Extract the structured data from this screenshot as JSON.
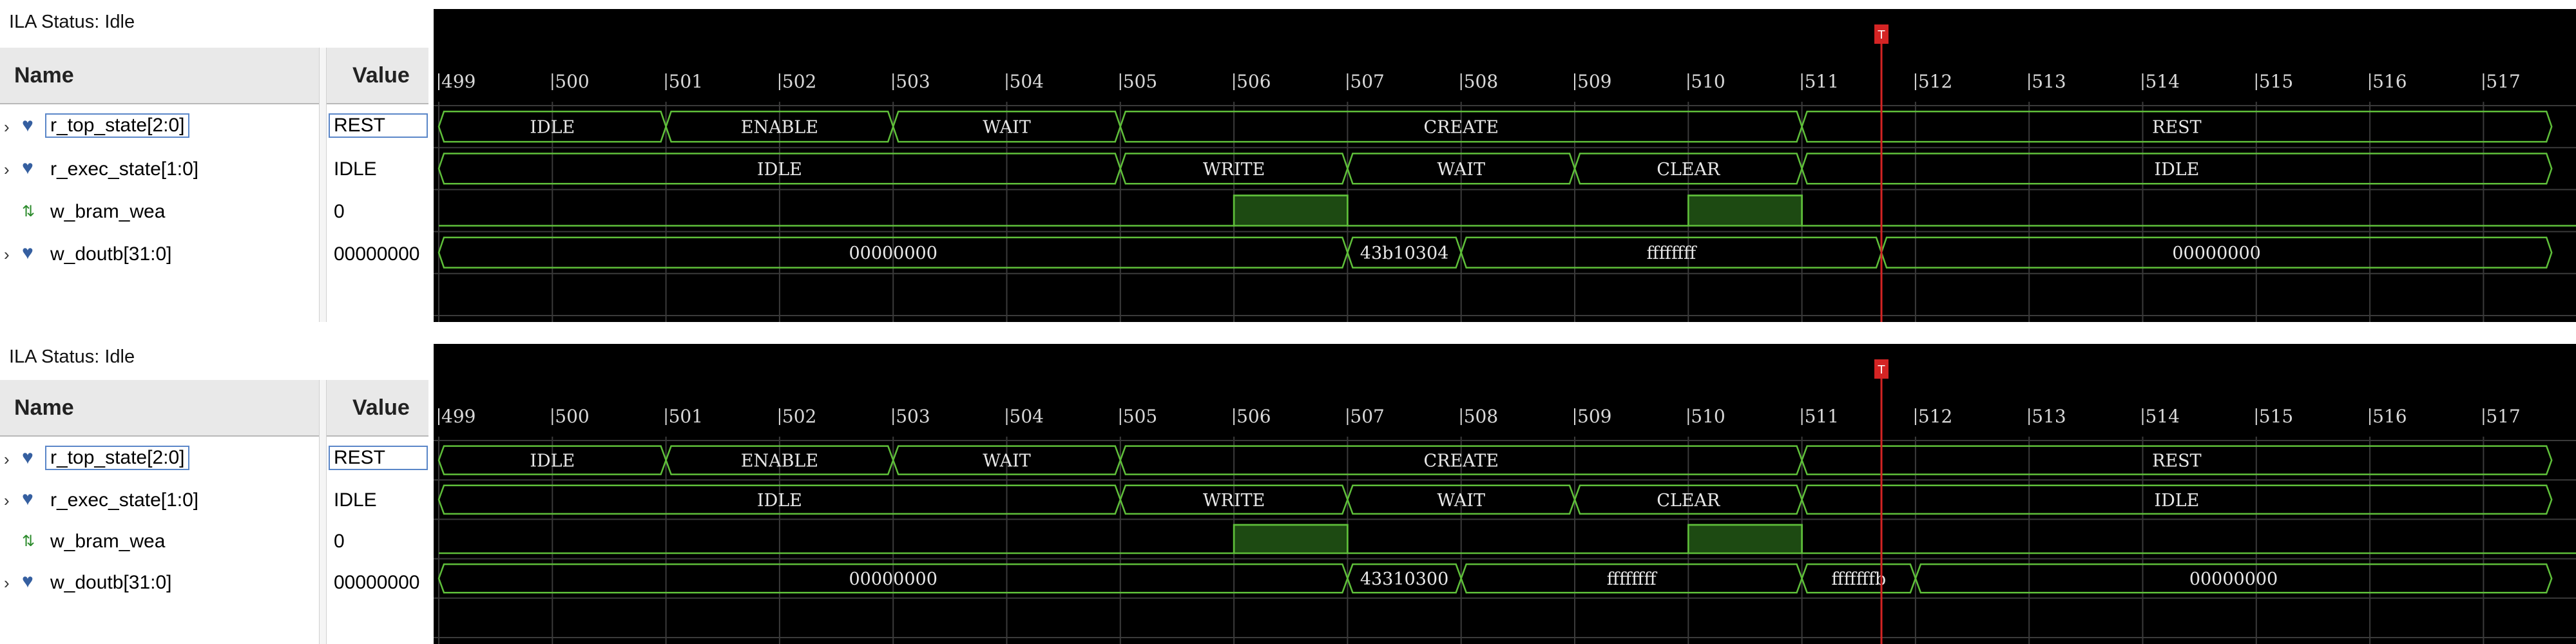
{
  "panels": [
    {
      "status": "ILA Status: Idle",
      "columns": {
        "name": "Name",
        "value": "Value"
      },
      "signals": [
        {
          "name": "r_top_state[2:0]",
          "value": "REST",
          "icon": "bus-icon",
          "expandable": true
        },
        {
          "name": "r_exec_state[1:0]",
          "value": "IDLE",
          "icon": "bus-icon",
          "expandable": true
        },
        {
          "name": "w_bram_wea",
          "value": "0",
          "icon": "bit-icon",
          "expandable": false
        },
        {
          "name": "w_doutb[31:0]",
          "value": "00000000",
          "icon": "bus-icon",
          "expandable": true
        }
      ],
      "ticks": [
        "499",
        "500",
        "501",
        "502",
        "503",
        "504",
        "505",
        "506",
        "507",
        "508",
        "509",
        "510",
        "511",
        "512",
        "513",
        "514",
        "515",
        "516",
        "517"
      ],
      "cursor": 511.7,
      "cursor_label": "T",
      "waves": [
        {
          "type": "bus",
          "segments": [
            {
              "from": 499,
              "to": 501,
              "label": "IDLE"
            },
            {
              "from": 501,
              "to": 503,
              "label": "ENABLE"
            },
            {
              "from": 503,
              "to": 505,
              "label": "WAIT"
            },
            {
              "from": 505,
              "to": 511,
              "label": "CREATE"
            },
            {
              "from": 511,
              "to": 517.6,
              "label": "REST"
            }
          ]
        },
        {
          "type": "bus",
          "segments": [
            {
              "from": 499,
              "to": 505,
              "label": "IDLE"
            },
            {
              "from": 505,
              "to": 507,
              "label": "WRITE"
            },
            {
              "from": 507,
              "to": 509,
              "label": "WAIT"
            },
            {
              "from": 509,
              "to": 511,
              "label": "CLEAR"
            },
            {
              "from": 511,
              "to": 517.6,
              "label": "IDLE"
            }
          ]
        },
        {
          "type": "bit",
          "high": [
            [
              506,
              507
            ],
            [
              510,
              511
            ]
          ]
        },
        {
          "type": "bus",
          "segments": [
            {
              "from": 499,
              "to": 507,
              "label": "00000000"
            },
            {
              "from": 507,
              "to": 508,
              "label": "43b10304"
            },
            {
              "from": 508,
              "to": 511.7,
              "label": "ffffffff"
            },
            {
              "from": 511.7,
              "to": 517.6,
              "label": "00000000"
            }
          ]
        }
      ]
    },
    {
      "status": "ILA Status: Idle",
      "columns": {
        "name": "Name",
        "value": "Value"
      },
      "signals": [
        {
          "name": "r_top_state[2:0]",
          "value": "REST",
          "icon": "bus-icon",
          "expandable": true
        },
        {
          "name": "r_exec_state[1:0]",
          "value": "IDLE",
          "icon": "bus-icon",
          "expandable": true
        },
        {
          "name": "w_bram_wea",
          "value": "0",
          "icon": "bit-icon",
          "expandable": false
        },
        {
          "name": "w_doutb[31:0]",
          "value": "00000000",
          "icon": "bus-icon",
          "expandable": true
        }
      ],
      "ticks": [
        "499",
        "500",
        "501",
        "502",
        "503",
        "504",
        "505",
        "506",
        "507",
        "508",
        "509",
        "510",
        "511",
        "512",
        "513",
        "514",
        "515",
        "516",
        "517"
      ],
      "cursor": 511.7,
      "cursor_label": "T",
      "waves": [
        {
          "type": "bus",
          "segments": [
            {
              "from": 499,
              "to": 501,
              "label": "IDLE"
            },
            {
              "from": 501,
              "to": 503,
              "label": "ENABLE"
            },
            {
              "from": 503,
              "to": 505,
              "label": "WAIT"
            },
            {
              "from": 505,
              "to": 511,
              "label": "CREATE"
            },
            {
              "from": 511,
              "to": 517.6,
              "label": "REST"
            }
          ]
        },
        {
          "type": "bus",
          "segments": [
            {
              "from": 499,
              "to": 505,
              "label": "IDLE"
            },
            {
              "from": 505,
              "to": 507,
              "label": "WRITE"
            },
            {
              "from": 507,
              "to": 509,
              "label": "WAIT"
            },
            {
              "from": 509,
              "to": 511,
              "label": "CLEAR"
            },
            {
              "from": 511,
              "to": 517.6,
              "label": "IDLE"
            }
          ]
        },
        {
          "type": "bit",
          "high": [
            [
              506,
              507
            ],
            [
              510,
              511
            ]
          ]
        },
        {
          "type": "bus",
          "segments": [
            {
              "from": 499,
              "to": 507,
              "label": "00000000"
            },
            {
              "from": 507,
              "to": 508,
              "label": "43310300"
            },
            {
              "from": 508,
              "to": 511,
              "label": "ffffffff"
            },
            {
              "from": 511,
              "to": 512,
              "label": "fffffffb"
            },
            {
              "from": 512,
              "to": 517.6,
              "label": "00000000"
            }
          ]
        }
      ]
    }
  ],
  "colors": {
    "wave_bg": "#000000",
    "wave_line": "#5fbf3a",
    "bit_fill": "#1d4a12",
    "grid": "#3a3a3a",
    "tick_text": "#d9d9d9",
    "label_text": "#e8e8e8",
    "cursor": "#d42424"
  }
}
